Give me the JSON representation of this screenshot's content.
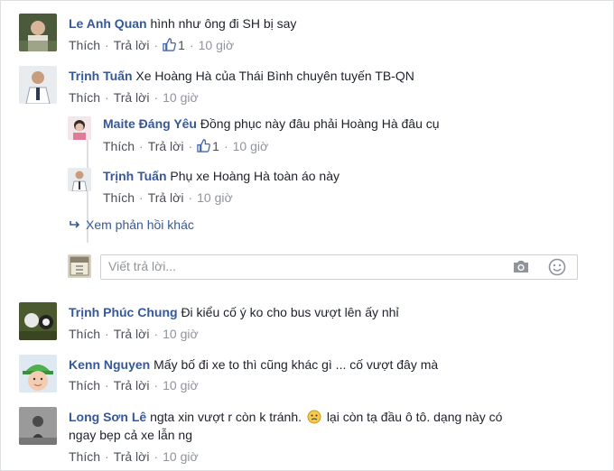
{
  "ui": {
    "like_label": "Thích",
    "reply_label": "Trả lời",
    "separator": "·",
    "more_replies": "Xem phản hồi khác",
    "reply_placeholder": "Viết trả lời..."
  },
  "comments": [
    {
      "name": "Le Anh Quan",
      "text": "hình như ông đi SH bị say",
      "likes": "1",
      "time": "10 giờ"
    },
    {
      "name": "Trịnh Tuấn",
      "text": "Xe Hoàng Hà của Thái Bình chuyên tuyến TB-QN",
      "time": "10 giờ",
      "replies": [
        {
          "name": "Maite Đáng Yêu",
          "text": "Đồng phục này đâu phải Hoàng Hà đâu cụ",
          "likes": "1",
          "time": "10 giờ"
        },
        {
          "name": "Trịnh Tuấn",
          "text": "Phụ xe Hoàng Hà toàn áo này",
          "time": "10 giờ"
        }
      ]
    },
    {
      "name": "Trịnh Phúc Chung",
      "text": "Đi kiểu cố ý ko cho bus vượt lên ấy nhỉ",
      "time": "10 giờ"
    },
    {
      "name": "Kenn Nguyen",
      "text": "Mấy bố đi xe to thì cũng khác gì ... cố vượt đây mà",
      "time": "10 giờ"
    },
    {
      "name": "Long Sơn Lê",
      "text": "ngta xin vượt r còn k tránh.",
      "text_cont": "lại còn tạ đầu ô tô. dạng này có",
      "text_line2": "ngay bẹp cả xe lẫn ng",
      "time": "10 giờ"
    }
  ],
  "icons": {
    "like": "thumbs-up-icon",
    "reply_arrow": "reply-arrow-icon",
    "camera": "camera-icon",
    "emoji": "smiley-icon",
    "inline_emoji": "emoji-icon"
  },
  "colors": {
    "name_link": "#365899",
    "meta_gray": "#90949c",
    "like_blue": "#4267b2"
  }
}
